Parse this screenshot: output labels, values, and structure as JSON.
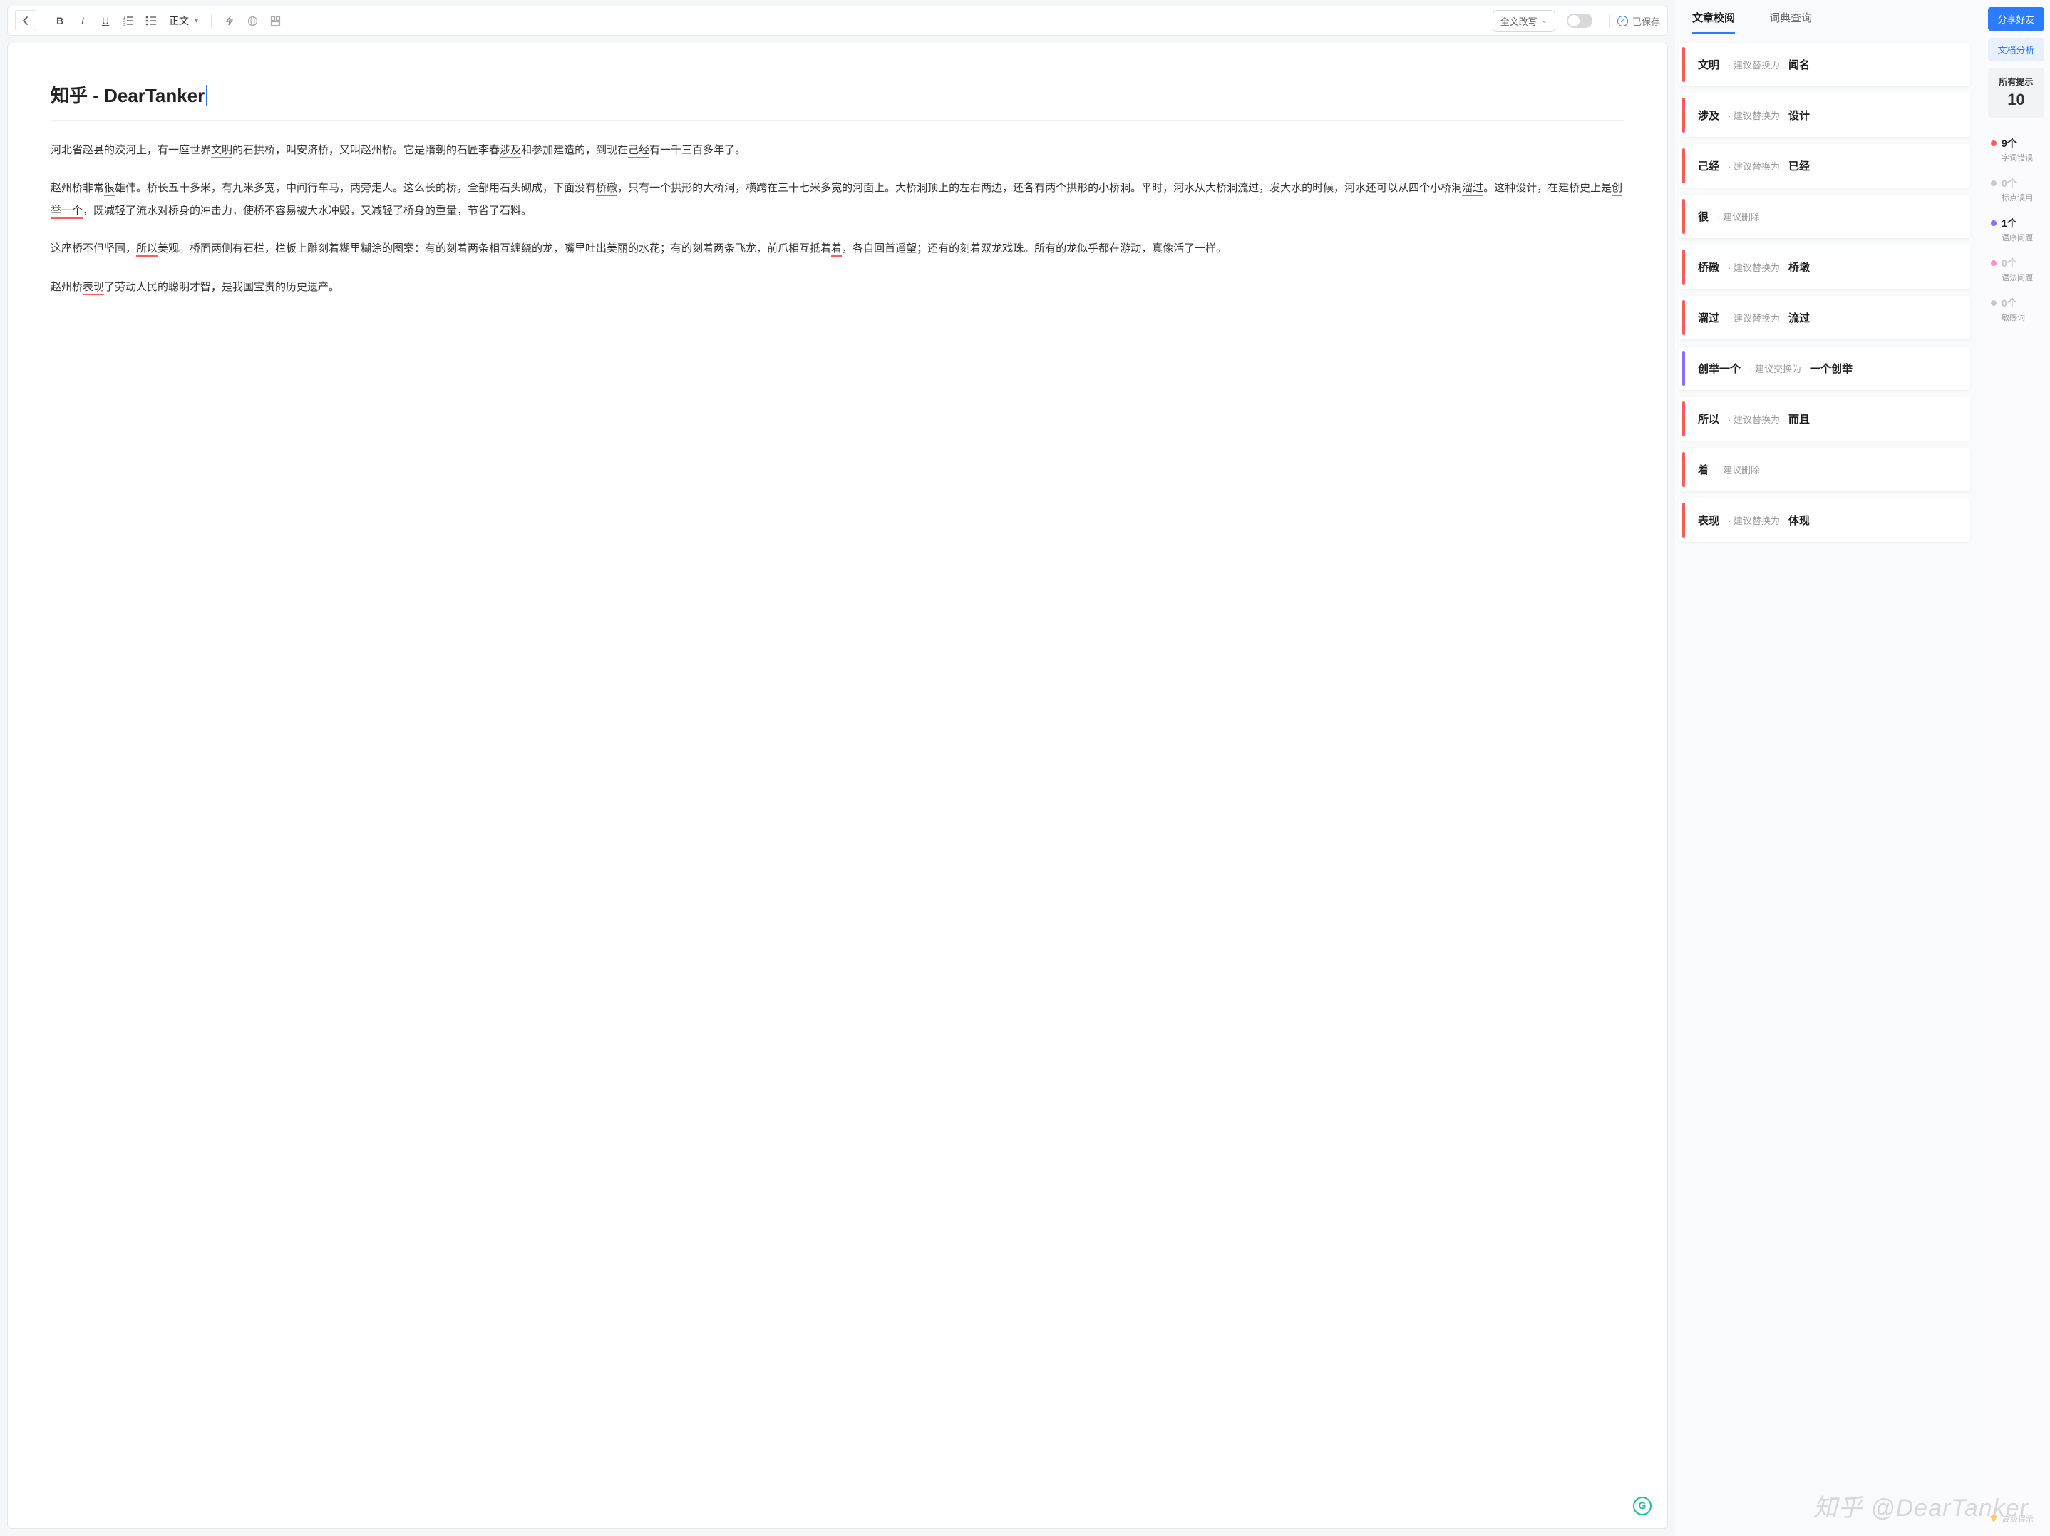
{
  "toolbar": {
    "back": "‹",
    "text_style_label": "正文",
    "rewrite_label": "全文改写",
    "saved_label": "已保存"
  },
  "doc": {
    "title": "知乎 - DearTanker",
    "p1": {
      "s0": "河北省赵县的洨河上，有一座世界",
      "e0": "文明",
      "s1": "的石拱桥，叫安济桥，又叫赵州桥。它是隋朝的石匠李春",
      "e1": "涉及",
      "s2": "和参加建造的，到现在",
      "e2": "己经",
      "s3": "有一千三百多年了。"
    },
    "p2": {
      "s0": "赵州桥非常",
      "e0": "很",
      "s1": "雄伟。桥长五十多米，有九米多宽，中间行车马，两旁走人。这么长的桥，全部用石头砌成，下面没有",
      "e1": "桥礅",
      "s2": "，只有一个拱形的大桥洞，横跨在三十七米多宽的河面上。大桥洞顶上的左右两边，还各有两个拱形的小桥洞。平时，河水从大桥洞流过，发大水的时候，河水还可以从四个小桥洞",
      "e2": "溜过",
      "s3": "。这种设计，在建桥史上是",
      "e3": "创举一个",
      "s4": "，既减轻了流水对桥身的冲击力，使桥不容易被大水冲毁，又减轻了桥身的重量，节省了石料。"
    },
    "p3": {
      "s0": "这座桥不但坚固，",
      "e0": "所以",
      "s1": "美观。桥面两侧有石栏，栏板上雕刻着糊里糊涂的图案：有的刻着两条相互缠绕的龙，嘴里吐出美丽的水花；有的刻着两条飞龙，前爪相互抵着",
      "e1": "着",
      "s2": "，各自回首遥望；还有的刻着双龙戏珠。所有的龙似乎都在游动，真像活了一样。"
    },
    "p4": {
      "s0": "赵州桥",
      "e0": "表现",
      "s1": "了劳动人民的聪明才智，是我国宝贵的历史遗产。"
    }
  },
  "tabs": {
    "proofread": "文章校阅",
    "dictionary": "词典查询"
  },
  "hints": {
    "replace": "· 建议替换为",
    "delete": "· 建议删除",
    "swap": "· 建议交换为"
  },
  "suggestions": [
    {
      "orig": "文明",
      "action": "replace",
      "repl": "闻名",
      "color": "red"
    },
    {
      "orig": "涉及",
      "action": "replace",
      "repl": "设计",
      "color": "red"
    },
    {
      "orig": "己经",
      "action": "replace",
      "repl": "已经",
      "color": "red"
    },
    {
      "orig": "很",
      "action": "delete",
      "repl": "",
      "color": "red"
    },
    {
      "orig": "桥礅",
      "action": "replace",
      "repl": "桥墩",
      "color": "red"
    },
    {
      "orig": "溜过",
      "action": "replace",
      "repl": "流过",
      "color": "red"
    },
    {
      "orig": "创举一个",
      "action": "swap",
      "repl": "一个创举",
      "color": "purple"
    },
    {
      "orig": "所以",
      "action": "replace",
      "repl": "而且",
      "color": "red"
    },
    {
      "orig": "着",
      "action": "delete",
      "repl": "",
      "color": "red"
    },
    {
      "orig": "表现",
      "action": "replace",
      "repl": "体现",
      "color": "red"
    }
  ],
  "sidebar": {
    "share": "分享好友",
    "analyze": "文档分析",
    "all_label": "所有提示",
    "all_count": "10",
    "cats": [
      {
        "count": "9个",
        "name": "字词错误",
        "color": "red",
        "dim": false
      },
      {
        "count": "0个",
        "name": "标点误用",
        "color": "grey",
        "dim": true
      },
      {
        "count": "1个",
        "name": "语序问题",
        "color": "purple",
        "dim": false
      },
      {
        "count": "0个",
        "name": "语法问题",
        "color": "pink",
        "dim": true
      },
      {
        "count": "0个",
        "name": "敏感词",
        "color": "grey",
        "dim": true
      }
    ],
    "premium": "高级提示"
  },
  "watermark": "知乎 @DearTanker"
}
